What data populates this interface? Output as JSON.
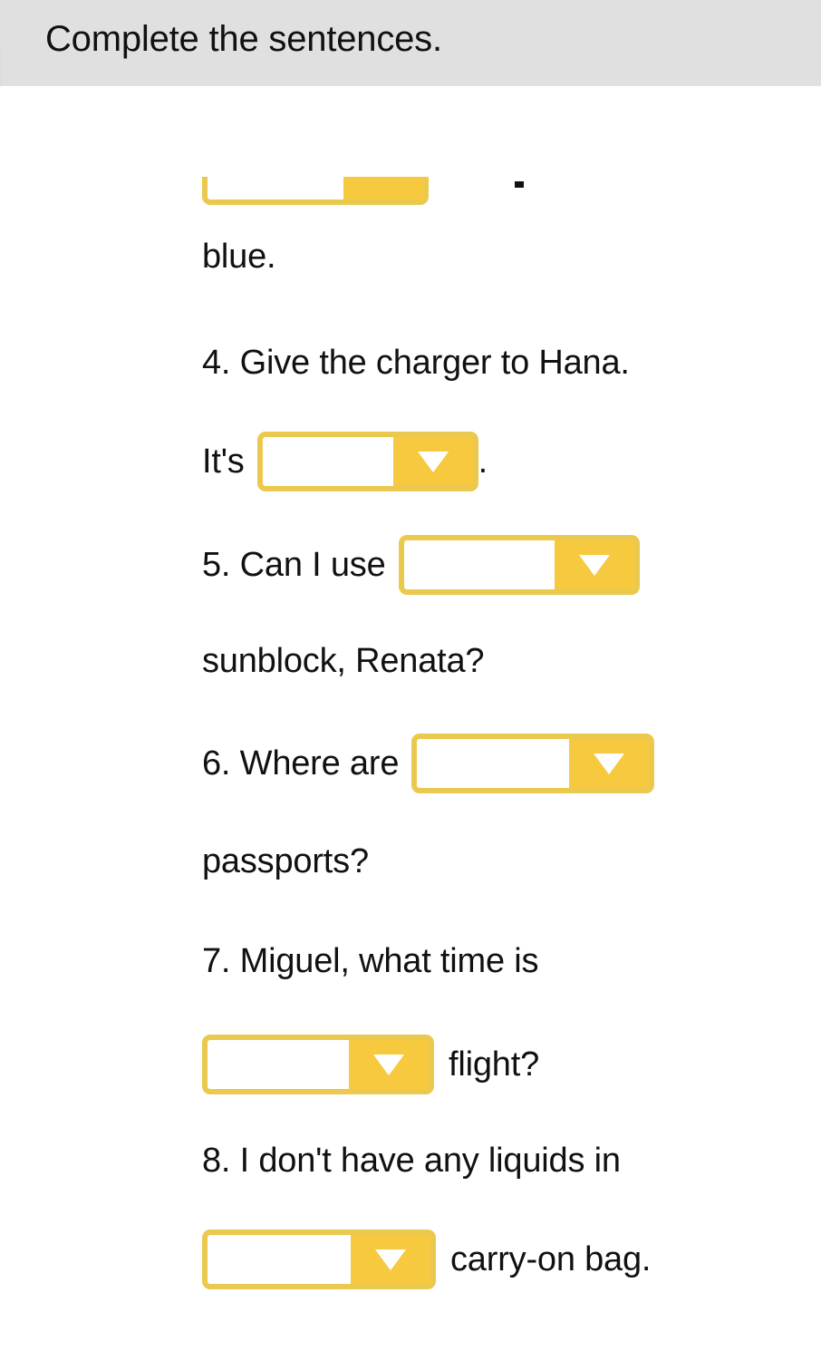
{
  "header": {
    "title": "Complete the sentences."
  },
  "colors": {
    "header_band": "#E0E0E0",
    "dropdown_fill": "#F7C93F",
    "dropdown_border": "#EBC94F",
    "caret": "#FFFFFF",
    "text": "#111111",
    "page_background": "#FFFFFF"
  },
  "exercise": {
    "lines": [
      {
        "id": "clipped-top",
        "kind": "clipped-dropdown",
        "text": ""
      },
      {
        "id": "blue",
        "kind": "text",
        "text": "blue."
      },
      {
        "id": "q4",
        "kind": "text",
        "text": "4. Give the charger to Hana."
      },
      {
        "id": "q4-answer",
        "kind": "text-dropdown-text",
        "before": "It's",
        "after": "."
      },
      {
        "id": "q5",
        "kind": "text-dropdown",
        "before": "5. Can I use",
        "after": ""
      },
      {
        "id": "q5-cont",
        "kind": "text",
        "text": "sunblock, Renata?"
      },
      {
        "id": "q6",
        "kind": "text-dropdown",
        "before": "6. Where are",
        "after": ""
      },
      {
        "id": "q6-cont",
        "kind": "text",
        "text": "passports?"
      },
      {
        "id": "q7",
        "kind": "text",
        "text": "7. Miguel, what time is"
      },
      {
        "id": "q7-answer",
        "kind": "dropdown-text",
        "before": "",
        "after": "flight?"
      },
      {
        "id": "q8",
        "kind": "text",
        "text": "8. I don't have any liquids in"
      },
      {
        "id": "q8-answer",
        "kind": "dropdown-text",
        "before": "",
        "after": "carry-on bag."
      }
    ],
    "dropdowns": [
      {
        "id": "dropdown-top",
        "value": "",
        "icon": "chevron-down-icon"
      },
      {
        "id": "dropdown-q4",
        "value": "",
        "icon": "chevron-down-icon"
      },
      {
        "id": "dropdown-q5",
        "value": "",
        "icon": "chevron-down-icon"
      },
      {
        "id": "dropdown-q6",
        "value": "",
        "icon": "chevron-down-icon"
      },
      {
        "id": "dropdown-q7",
        "value": "",
        "icon": "chevron-down-icon"
      },
      {
        "id": "dropdown-q8",
        "value": "",
        "icon": "chevron-down-icon"
      }
    ]
  }
}
